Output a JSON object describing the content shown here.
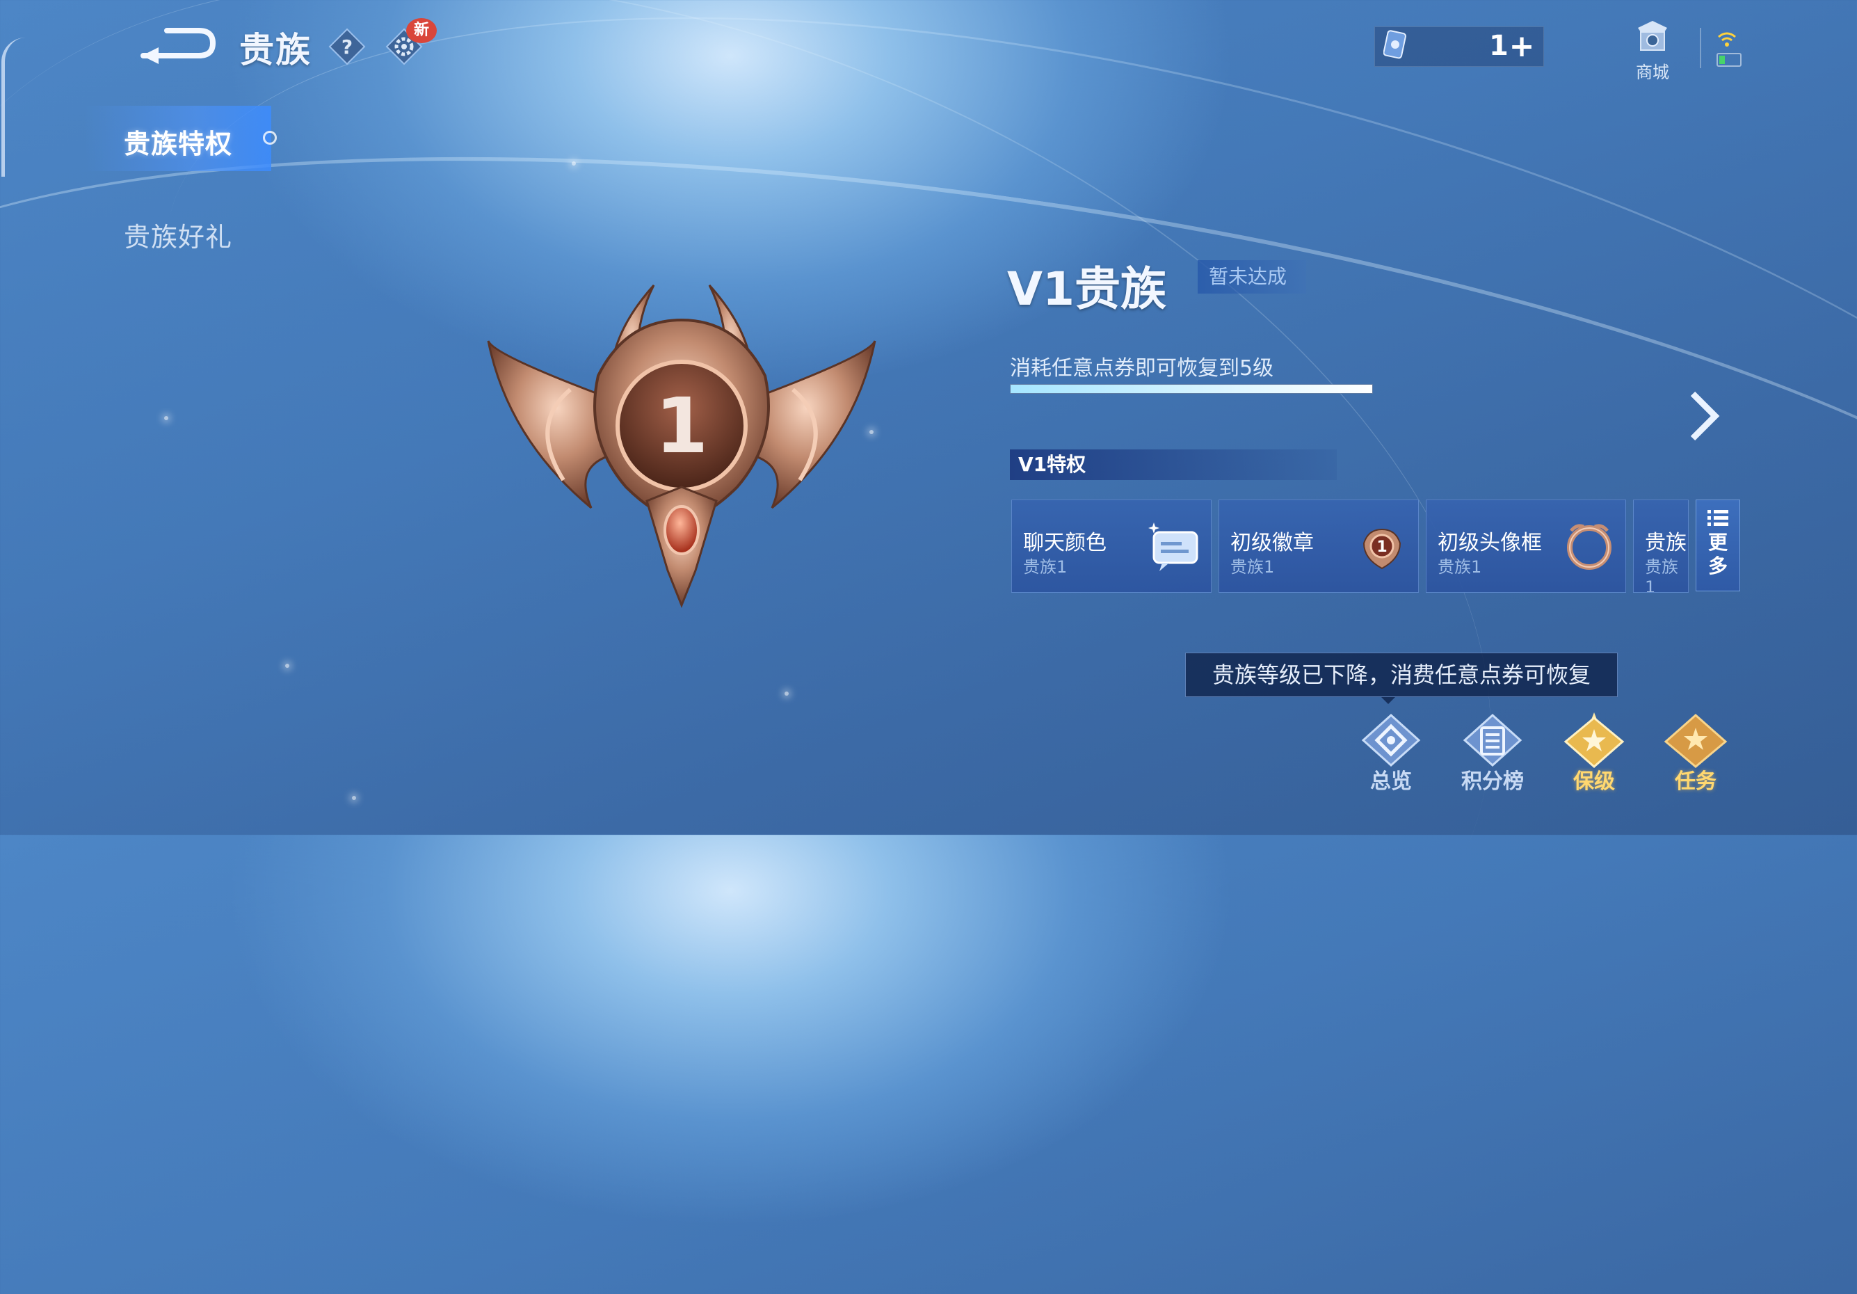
{
  "header": {
    "title": "贵族",
    "new_badge": "新",
    "help_icon": "question-icon",
    "settings_icon": "gear-icon"
  },
  "currency": {
    "count": "1",
    "plus": "+",
    "icon": "point-coupon-icon"
  },
  "shop": {
    "label": "商城",
    "icon": "shop-icon"
  },
  "sidebar": {
    "items": [
      {
        "label": "贵族特权",
        "active": true
      },
      {
        "label": "贵族好礼",
        "active": false
      }
    ]
  },
  "emblem": {
    "level_number": "1",
    "color": "#b9826a"
  },
  "panel": {
    "level_title": "V1贵族",
    "status": "暂未达成",
    "progress_text": "消耗任意点券即可恢复到5级",
    "progress_fraction": 1.0,
    "privileges_header": "V1特权",
    "cards": [
      {
        "name": "聊天颜色",
        "sub": "贵族1",
        "icon": "chat-bubble-icon"
      },
      {
        "name": "初级徽章",
        "sub": "贵族1",
        "icon": "badge-icon"
      },
      {
        "name": "初级头像框",
        "sub": "贵族1",
        "icon": "avatar-frame-icon"
      },
      {
        "name": "贵族",
        "sub": "贵族1",
        "icon": ""
      }
    ],
    "more_label": "更多"
  },
  "tooltip": "贵族等级已下降，消费任意点券可恢复",
  "bottom_tabs": [
    {
      "label": "总览",
      "icon": "overview-icon",
      "style": "blue"
    },
    {
      "label": "积分榜",
      "icon": "leaderboard-icon",
      "style": "blue"
    },
    {
      "label": "保级",
      "icon": "keep-level-icon",
      "style": "gold"
    },
    {
      "label": "任务",
      "icon": "task-icon",
      "style": "gold"
    }
  ],
  "colors": {
    "accent_gold": "#ffd870",
    "panel_blue": "#3a6ab4",
    "background": "#4479b8"
  }
}
